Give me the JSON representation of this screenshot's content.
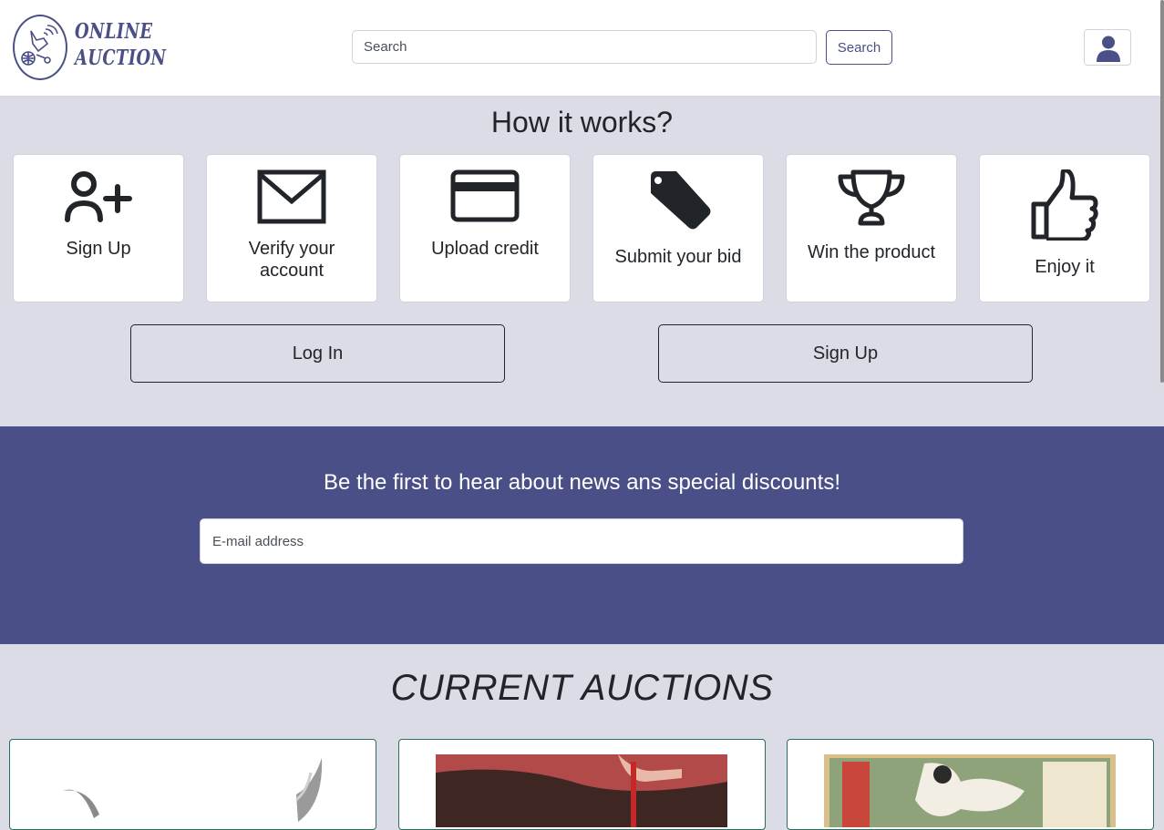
{
  "header": {
    "logo_line1": "ONLINE",
    "logo_line2": "AUCTION",
    "search_placeholder": "Search",
    "search_button": "Search",
    "user_icon": "user-icon"
  },
  "how_it_works": {
    "title": "How it works?",
    "steps": [
      {
        "label": "Sign Up",
        "icon": "user-plus-icon"
      },
      {
        "label": "Verify your account",
        "icon": "envelope-icon"
      },
      {
        "label": "Upload credit",
        "icon": "credit-card-icon"
      },
      {
        "label": "Submit your bid",
        "icon": "tag-icon"
      },
      {
        "label": "Win the product",
        "icon": "trophy-icon"
      },
      {
        "label": "Enjoy it",
        "icon": "thumbs-up-icon"
      }
    ],
    "login_button": "Log In",
    "signup_button": "Sign Up"
  },
  "newsletter": {
    "title": "Be the first to hear about news ans special discounts!",
    "email_placeholder": "E-mail address"
  },
  "auctions": {
    "title": "CURRENT AUCTIONS"
  },
  "colors": {
    "brand": "#4a4f87",
    "page_bg": "#dcdce6",
    "card_border": "#2f6b5f"
  }
}
